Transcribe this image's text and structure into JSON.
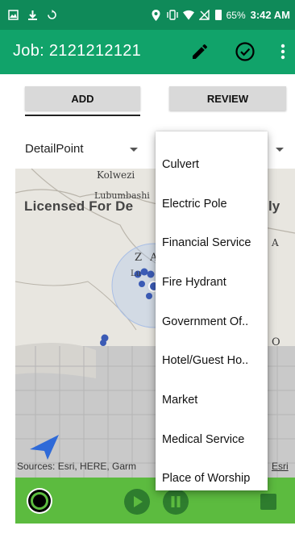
{
  "status_bar": {
    "battery_percent": "65%",
    "time": "3:42 AM",
    "left_icons": [
      "image-icon",
      "download-icon",
      "sync-icon"
    ],
    "right_icons": [
      "location-icon",
      "vibrate-icon",
      "wifi-icon",
      "no-signal-icon",
      "battery-icon"
    ]
  },
  "app_bar": {
    "title": "Job: 2121212121",
    "actions": [
      "edit-icon",
      "check-circle-icon",
      "more-vert-icon"
    ],
    "color": "#11a36a"
  },
  "tabs": {
    "add_label": "ADD",
    "review_label": "REVIEW",
    "active": "ADD"
  },
  "filters": {
    "left_select_value": "DetailPoint"
  },
  "map": {
    "watermark_left": "Licensed For De",
    "watermark_right": "ly",
    "place_kolwezi": "Kolwezi",
    "place_lubumbashi": "Lubumbashi",
    "place_za": "Z A",
    "place_lu": "Lu",
    "place_a": "A",
    "place_o": "O",
    "attribution_visible": "Sources: Esri, HERE, Garm",
    "attribution_right": "Esri"
  },
  "dropdown": {
    "items": [
      "Culvert",
      "Electric Pole",
      "Financial Service",
      "Fire Hydrant",
      "Government Of..",
      "Hotel/Guest Ho..",
      "Market",
      "Medical Service",
      "Place of Worship"
    ]
  },
  "bottom_bar": {
    "color": "#5cbb3f",
    "controls": [
      "record-icon",
      "play-icon",
      "pause-icon",
      "stop-icon"
    ]
  }
}
